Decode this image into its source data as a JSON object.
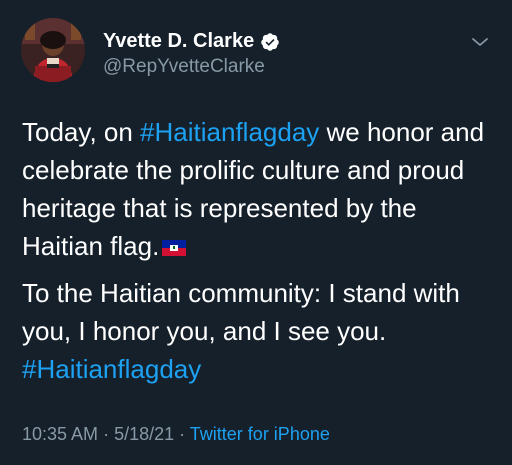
{
  "author": {
    "display_name": "Yvette D. Clarke",
    "handle": "@RepYvetteClarke",
    "verified": true
  },
  "tweet": {
    "p1_before": "Today, on ",
    "p1_hashtag": "#Haitianflagday",
    "p1_after": " we honor and celebrate the prolific culture and proud heritage that is represented by the Haitian flag.",
    "p1_emoji": "haiti-flag",
    "p2_text": "To the Haitian community: I stand with you, I honor you, and I see you. ",
    "p2_hashtag": "#Haitianflagday"
  },
  "meta": {
    "time": "10:35 AM",
    "separator1": " · ",
    "date": "5/18/21",
    "separator2": " · ",
    "source": "Twitter for iPhone"
  },
  "colors": {
    "background": "#15202b",
    "link": "#1da1f2",
    "secondary_text": "#8899a6",
    "primary_text": "#ffffff"
  },
  "icons": {
    "verified": "verified-badge-icon",
    "more": "chevron-down-icon"
  }
}
